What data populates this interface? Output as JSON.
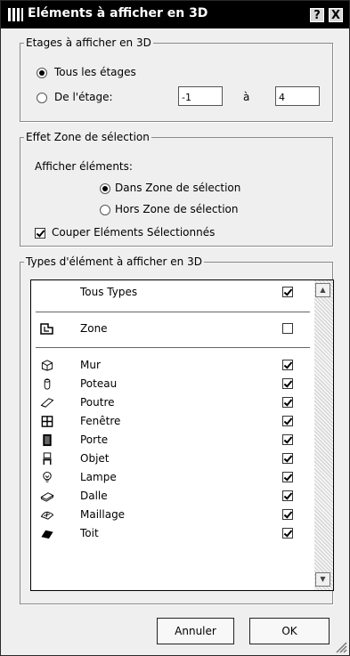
{
  "window": {
    "title": "Eléments à afficher en 3D",
    "help_label": "?",
    "close_label": "X"
  },
  "floors": {
    "legend": "Etages à afficher en 3D",
    "all_label": "Tous les étages",
    "from_label": "De l'étage:",
    "from_value": "-1",
    "to_label": "à",
    "to_value": "4",
    "selected": "all"
  },
  "marquee": {
    "legend": "Effet Zone de sélection",
    "show_label": "Afficher éléments:",
    "inside_label": "Dans Zone de sélection",
    "outside_label": "Hors Zone de sélection",
    "selected": "inside",
    "cut_label": "Couper Eléments Sélectionnés",
    "cut_checked": true
  },
  "types": {
    "legend": "Types d'élément à afficher en 3D",
    "all_types": {
      "label": "Tous Types",
      "checked": true
    },
    "zone": {
      "label": "Zone",
      "icon": "zone-icon",
      "checked": false
    },
    "items": [
      {
        "label": "Mur",
        "icon": "wall-icon",
        "checked": true
      },
      {
        "label": "Poteau",
        "icon": "column-icon",
        "checked": true
      },
      {
        "label": "Poutre",
        "icon": "beam-icon",
        "checked": true
      },
      {
        "label": "Fenêtre",
        "icon": "window-icon",
        "checked": true
      },
      {
        "label": "Porte",
        "icon": "door-icon",
        "checked": true
      },
      {
        "label": "Objet",
        "icon": "object-icon",
        "checked": true
      },
      {
        "label": "Lampe",
        "icon": "lamp-icon",
        "checked": true
      },
      {
        "label": "Dalle",
        "icon": "slab-icon",
        "checked": true
      },
      {
        "label": "Maillage",
        "icon": "mesh-icon",
        "checked": true
      },
      {
        "label": "Toit",
        "icon": "roof-icon",
        "checked": true
      }
    ]
  },
  "buttons": {
    "cancel": "Annuler",
    "ok": "OK"
  }
}
